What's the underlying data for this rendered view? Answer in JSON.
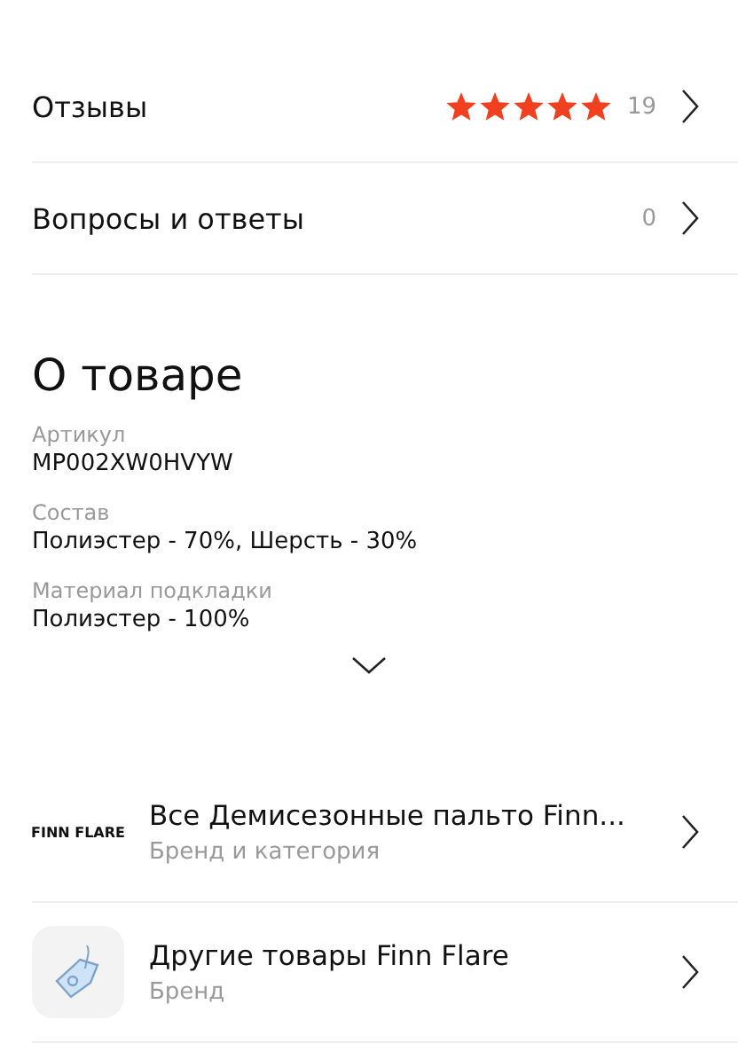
{
  "links": [
    {
      "kind": "rating",
      "label": "Отзывы",
      "stars": 5,
      "count": "19"
    },
    {
      "kind": "count",
      "label": "Вопросы и ответы",
      "count": "0"
    }
  ],
  "about": {
    "title": "О товаре",
    "specs": [
      {
        "label": "Артикул",
        "value": "MP002XW0HVYW"
      },
      {
        "label": "Состав",
        "value": "Полиэстер - 70%, Шерсть - 30%"
      },
      {
        "label": "Материал подкладки",
        "value": "Полиэстер - 100%"
      }
    ],
    "expanded": false
  },
  "brand_links": [
    {
      "kind": "logo",
      "logo": "FINN FLARE",
      "title": "Все Демисезонные пальто Finn...",
      "subtitle": "Бренд и категория"
    },
    {
      "kind": "tag-icon",
      "title": "Другие товары Finn Flare",
      "subtitle": "Бренд"
    }
  ]
}
